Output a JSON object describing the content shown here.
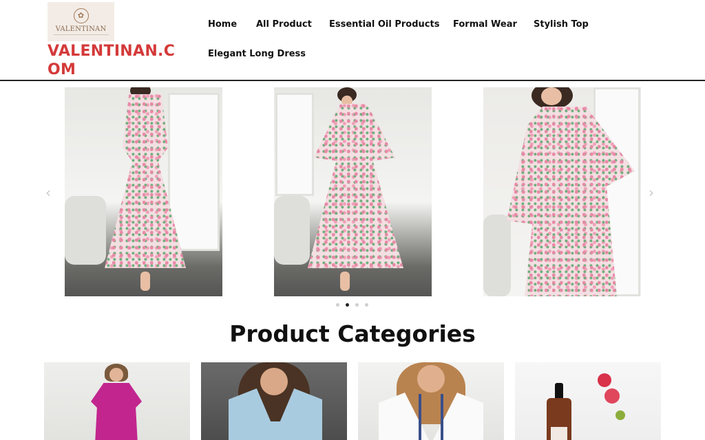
{
  "brand": {
    "logo_text": "VALENTINAN",
    "site_title": "VALENTINAN.COM"
  },
  "nav": {
    "items": [
      {
        "label": "Home"
      },
      {
        "label": "All Product"
      },
      {
        "label": "Essential Oil Products"
      },
      {
        "label": "Formal Wear"
      },
      {
        "label": "Stylish Top"
      },
      {
        "label": "Elegant Long Dress"
      }
    ]
  },
  "carousel": {
    "prev_icon": "‹",
    "next_icon": "›",
    "slides": [
      {
        "alt": "Floral long-sleeve maxi dress back view"
      },
      {
        "alt": "Floral long-sleeve maxi dress with bouquet"
      },
      {
        "alt": "Floral long-sleeve maxi dress front view"
      }
    ],
    "dot_count": 4,
    "active_dot": 1
  },
  "categories": {
    "heading": "Product Categories",
    "cards": [
      {
        "alt": "Magenta dress"
      },
      {
        "alt": "Light blue shirt"
      },
      {
        "alt": "White embroidered top"
      },
      {
        "alt": "Rosehip essential oil"
      }
    ]
  },
  "colors": {
    "brand_red": "#d43a3a",
    "active_dot": "#222222"
  }
}
